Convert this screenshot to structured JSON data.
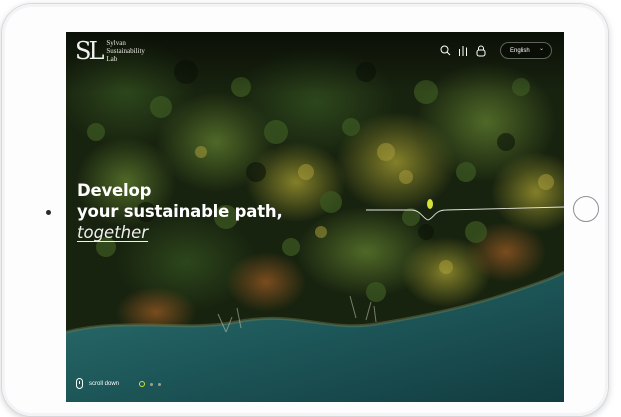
{
  "brand": {
    "mark": "SL",
    "name_lines": [
      "Sylvan",
      "Sustainability",
      "Lab"
    ]
  },
  "header": {
    "language": "English",
    "icons": [
      "search-icon",
      "bars-icon",
      "lock-icon",
      "chevron-down-icon"
    ]
  },
  "hero": {
    "line1": "Develop",
    "line2": "your sustainable path,",
    "accent": "together"
  },
  "scroll": {
    "label": "scroll down"
  },
  "carousel": {
    "slides": 3,
    "active_index": 0
  },
  "colors": {
    "accent": "#d6e23a",
    "forest_dark": "#16200f",
    "water": "#1f5b5e",
    "text": "#ffffff"
  }
}
